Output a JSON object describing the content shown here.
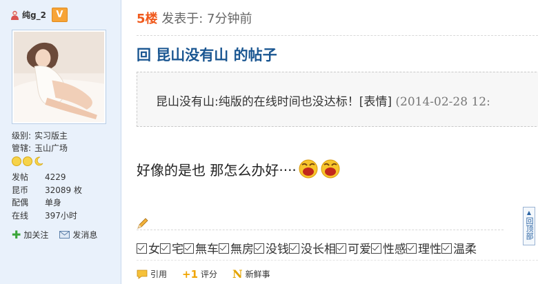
{
  "user": {
    "name": "纯g_2",
    "vip_badge": "V",
    "rank_label": "级别:",
    "rank_value": "实习版主",
    "manage_label": "管辖:",
    "manage_value": "玉山广场",
    "stats": [
      {
        "label": "发帖",
        "value": "4229"
      },
      {
        "label": "昆币",
        "value": "32089 枚"
      },
      {
        "label": "配偶",
        "value": "单身"
      },
      {
        "label": "在线",
        "value": "397小时"
      }
    ],
    "actions": {
      "follow": "加关注",
      "message": "发消息"
    }
  },
  "post": {
    "floor": "5楼",
    "posted_at": "发表于: 7分钟前",
    "title": "回 昆山没有山 的帖子",
    "quote_text": "昆山没有山:纯版的在线时间也没达标！[表情] ",
    "quote_time": "(2014-02-28 12:",
    "content": "好像的是也  那怎么办好····",
    "tags": [
      "女",
      "宅",
      "無车",
      "無房",
      "没钱",
      "没长相",
      "可爱",
      "性感",
      "理性",
      "温柔"
    ],
    "bottom_actions": {
      "quote": "引用",
      "rate_symbol": "+1",
      "rate": "评分",
      "fresh_symbol": "N",
      "fresh": "新鲜事"
    }
  },
  "back_to_top": {
    "label": "回顶部"
  }
}
